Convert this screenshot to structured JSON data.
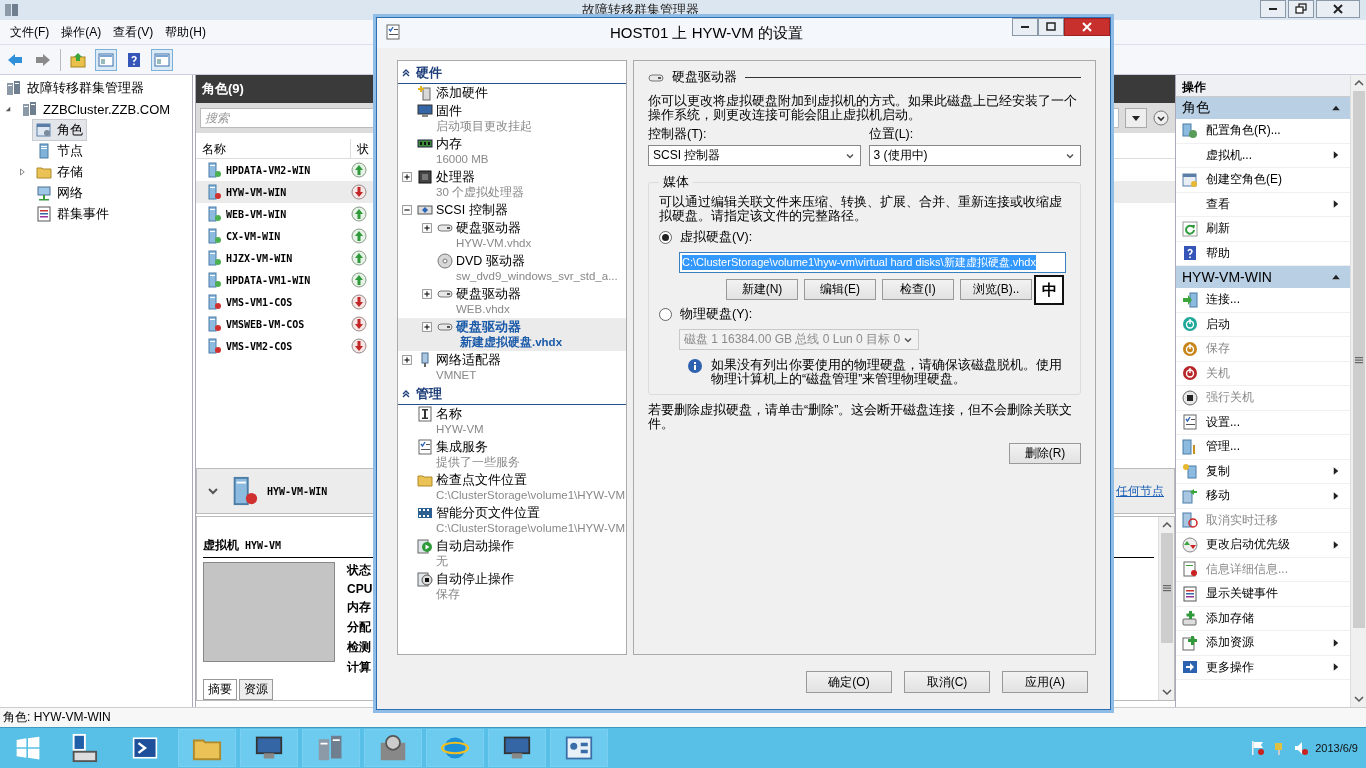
{
  "app": {
    "title": "故障转移群集管理器"
  },
  "menu": [
    "文件(F)",
    "操作(A)",
    "查看(V)",
    "帮助(H)"
  ],
  "nav_tree": {
    "label": "故障转移群集管理器",
    "children": [
      {
        "label": "ZZBCluster.ZZB.COM",
        "expanded": true,
        "selected": false,
        "children": [
          {
            "label": "角色",
            "selected": true
          },
          {
            "label": "节点",
            "selected": false
          },
          {
            "label": "存储",
            "selected": false,
            "expanded": false
          },
          {
            "label": "网络",
            "selected": false
          },
          {
            "label": "群集事件",
            "selected": false
          }
        ]
      }
    ]
  },
  "roles": {
    "title": "角色(9)",
    "search": {
      "placeholder": "搜索"
    },
    "columns": [
      "名称",
      "状"
    ],
    "rows": [
      {
        "name": "HPDATA-VM2-WIN",
        "running": true,
        "selected": false
      },
      {
        "name": "HYW-VM-WIN",
        "running": false,
        "selected": true
      },
      {
        "name": "WEB-VM-WIN",
        "running": true,
        "selected": false
      },
      {
        "name": "CX-VM-WIN",
        "running": true,
        "selected": false
      },
      {
        "name": "HJZX-VM-WIN",
        "running": true,
        "selected": false
      },
      {
        "name": "HPDATA-VM1-WIN",
        "running": true,
        "selected": false
      },
      {
        "name": "VMS-VM1-COS",
        "running": false,
        "selected": false
      },
      {
        "name": "VMSWEB-VM-COS",
        "running": false,
        "selected": false
      },
      {
        "name": "VMS-VM2-COS",
        "running": false,
        "selected": false
      }
    ]
  },
  "summary": {
    "expanded": true,
    "name": "HYW-VM-WIN",
    "running": false,
    "link": "任何节点",
    "heading_label": "虚拟机",
    "heading_value": "HYW-VM",
    "fields": [
      "状态",
      "CPU",
      "内存",
      "分配",
      "检测",
      "计算"
    ],
    "tabs": [
      {
        "label": "摘要",
        "selected": true
      },
      {
        "label": "资源",
        "selected": false
      }
    ]
  },
  "actions": {
    "title": "操作",
    "groups": [
      {
        "title": "角色",
        "expanded": true,
        "items": [
          {
            "label": "配置角色(R)...",
            "submenu": false,
            "disabled": false
          },
          {
            "label": "虚拟机...",
            "submenu": true,
            "disabled": false
          },
          {
            "label": "创建空角色(E)",
            "submenu": false,
            "disabled": false
          },
          {
            "label": "查看",
            "submenu": true,
            "disabled": false
          },
          {
            "label": "刷新",
            "submenu": false,
            "disabled": false
          },
          {
            "label": "帮助",
            "submenu": false,
            "disabled": false
          }
        ]
      },
      {
        "title": "HYW-VM-WIN",
        "expanded": true,
        "items": [
          {
            "label": "连接...",
            "submenu": false,
            "disabled": false
          },
          {
            "label": "启动",
            "submenu": false,
            "disabled": false
          },
          {
            "label": "保存",
            "submenu": false,
            "disabled": true
          },
          {
            "label": "关机",
            "submenu": false,
            "disabled": true
          },
          {
            "label": "强行关机",
            "submenu": false,
            "disabled": true
          },
          {
            "label": "设置...",
            "submenu": false,
            "disabled": false
          },
          {
            "label": "管理...",
            "submenu": false,
            "disabled": false
          },
          {
            "label": "复制",
            "submenu": true,
            "disabled": false
          },
          {
            "label": "移动",
            "submenu": true,
            "disabled": false
          },
          {
            "label": "取消实时迁移",
            "submenu": false,
            "disabled": true
          },
          {
            "label": "更改启动优先级",
            "submenu": true,
            "disabled": false
          },
          {
            "label": "信息详细信息...",
            "submenu": false,
            "disabled": true
          },
          {
            "label": "显示关键事件",
            "submenu": false,
            "disabled": false
          },
          {
            "label": "添加存储",
            "submenu": false,
            "disabled": false
          },
          {
            "label": "添加资源",
            "submenu": true,
            "disabled": false
          },
          {
            "label": "更多操作",
            "submenu": true,
            "disabled": false
          }
        ]
      }
    ]
  },
  "status_bar": "角色: HYW-VM-WIN",
  "taskbar": {
    "date": "2013/6/9"
  },
  "dialog": {
    "title": "HOST01 上 HYW-VM 的设置",
    "tree": [
      {
        "title": "硬件",
        "expanded": true,
        "items": [
          {
            "label": "添加硬件",
            "selected": false
          },
          {
            "label": "固件",
            "sub": "启动项目更改挂起",
            "selected": false
          },
          {
            "label": "内存",
            "sub": "16000 MB",
            "selected": false
          },
          {
            "label": "处理器",
            "sub": "30 个虚拟处理器",
            "expanded": false,
            "selected": false
          },
          {
            "label": "SCSI 控制器",
            "expanded": true,
            "selected": false,
            "children": [
              {
                "label": "硬盘驱动器",
                "sub": "HYW-VM.vhdx",
                "expanded": false,
                "selected": false
              },
              {
                "label": "DVD 驱动器",
                "sub": "sw_dvd9_windows_svr_std_a...",
                "selected": false
              },
              {
                "label": "硬盘驱动器",
                "sub": "WEB.vhdx",
                "expanded": false,
                "selected": false
              },
              {
                "label": "硬盘驱动器",
                "sub": "新建虚拟硬盘.vhdx",
                "expanded": false,
                "selected": true
              }
            ]
          },
          {
            "label": "网络适配器",
            "sub": "VMNET",
            "expanded": false,
            "selected": false
          }
        ]
      },
      {
        "title": "管理",
        "expanded": true,
        "items": [
          {
            "label": "名称",
            "sub": "HYW-VM",
            "selected": false
          },
          {
            "label": "集成服务",
            "sub": "提供了一些服务",
            "selected": false
          },
          {
            "label": "检查点文件位置",
            "sub": "C:\\ClusterStorage\\volume1\\HYW-VM",
            "selected": false
          },
          {
            "label": "智能分页文件位置",
            "sub": "C:\\ClusterStorage\\volume1\\HYW-VM",
            "selected": false
          },
          {
            "label": "自动启动操作",
            "sub": "无",
            "selected": false
          },
          {
            "label": "自动停止操作",
            "sub": "保存",
            "selected": false
          }
        ]
      }
    ],
    "settings": {
      "heading": "硬盘驱动器",
      "description": "你可以更改将虚拟硬盘附加到虚拟机的方式。如果此磁盘上已经安装了一个操作系统，则更改连接可能会阻止虚拟机启动。",
      "controller": {
        "label": "控制器(T):",
        "value": "SCSI 控制器"
      },
      "location": {
        "label": "位置(L):",
        "value": "3 (使用中)"
      },
      "media": {
        "title": "媒体",
        "description": "可以通过编辑关联文件来压缩、转换、扩展、合并、重新连接或收缩虚拟硬盘。请指定该文件的完整路径。",
        "virtual": {
          "label": "虚拟硬盘(V):",
          "selected": true,
          "path": "C:\\ClusterStorage\\volume1\\hyw-vm\\virtual hard disks\\新建虚拟硬盘.vhdx",
          "buttons": [
            "新建(N)",
            "编辑(E)",
            "检查(I)",
            "浏览(B).."
          ]
        },
        "physical": {
          "label": "物理硬盘(Y):",
          "selected": false,
          "value": "磁盘 1 16384.00 GB 总线 0 Lun 0 目标 0",
          "disabled": true
        },
        "note": "如果没有列出你要使用的物理硬盘，请确保该磁盘脱机。使用物理计算机上的“磁盘管理”来管理物理硬盘。"
      },
      "remove_note": "若要删除虚拟硬盘，请单击“删除”。这会断开磁盘连接，但不会删除关联文件。",
      "remove_button": "删除(R)"
    },
    "ime_indicator": "中",
    "buttons": [
      "确定(O)",
      "取消(C)",
      "应用(A)"
    ]
  }
}
